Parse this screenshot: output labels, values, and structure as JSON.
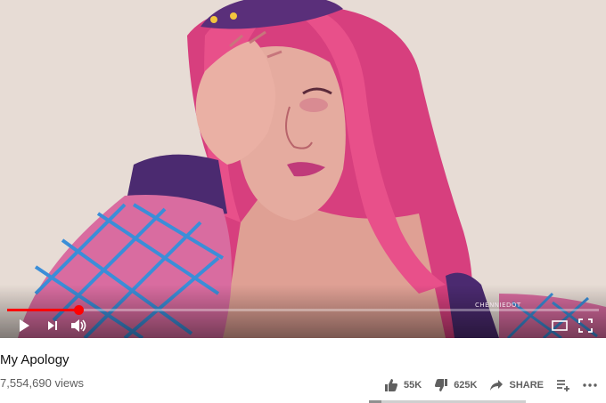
{
  "video": {
    "title": "My Apology",
    "views": "7,554,690 views",
    "watermark": "CHENNIEDOT",
    "progress_fraction": 0.12
  },
  "player_controls": {
    "play_icon": "play-icon",
    "next_icon": "next-icon",
    "volume_icon": "volume-icon",
    "theater_icon": "theater-mode-icon",
    "fullscreen_icon": "fullscreen-icon"
  },
  "actions": {
    "like_count": "55K",
    "dislike_count": "625K",
    "share_label": "SHARE",
    "like_ratio": 0.081
  },
  "colors": {
    "progress": "#ff0000",
    "hair": "#e0457f",
    "skin": "#e3a89f",
    "background": "#e7dcd5"
  }
}
